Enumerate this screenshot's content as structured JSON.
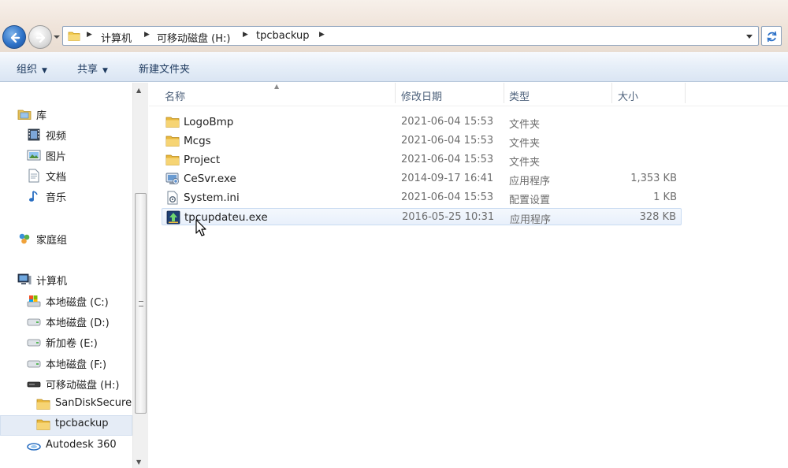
{
  "address_bar": {
    "crumbs": [
      "计算机",
      "可移动磁盘 (H:)",
      "tpcbackup"
    ]
  },
  "command_bar": {
    "organize": "组织",
    "share": "共享",
    "new_folder": "新建文件夹"
  },
  "nav_pane": {
    "libraries": {
      "label": "库",
      "items": [
        "视频",
        "图片",
        "文档",
        "音乐"
      ]
    },
    "homegroup": "家庭组",
    "computer": {
      "label": "计算机",
      "drives": [
        "本地磁盘 (C:)",
        "本地磁盘 (D:)",
        "新加卷 (E:)",
        "本地磁盘 (F:)",
        "可移动磁盘 (H:)"
      ],
      "subfolders": [
        "SanDiskSecure",
        "tpcbackup"
      ],
      "selected": "tpcbackup"
    },
    "autodesk": "Autodesk 360"
  },
  "file_list": {
    "columns": {
      "name": "名称",
      "date": "修改日期",
      "type": "类型",
      "size": "大小"
    },
    "rows": [
      {
        "name": "LogoBmp",
        "date": "2021-06-04 15:53",
        "type": "文件夹",
        "size": "",
        "icon": "folder-icon"
      },
      {
        "name": "Mcgs",
        "date": "2021-06-04 15:53",
        "type": "文件夹",
        "size": "",
        "icon": "folder-icon"
      },
      {
        "name": "Project",
        "date": "2021-06-04 15:53",
        "type": "文件夹",
        "size": "",
        "icon": "folder-icon"
      },
      {
        "name": "CeSvr.exe",
        "date": "2014-09-17 16:41",
        "type": "应用程序",
        "size": "1,353 KB",
        "icon": "exe-monitor-icon"
      },
      {
        "name": "System.ini",
        "date": "2021-06-04 15:53",
        "type": "配置设置",
        "size": "1 KB",
        "icon": "ini-settings-icon"
      },
      {
        "name": "tpcupdateu.exe",
        "date": "2016-05-25 10:31",
        "type": "应用程序",
        "size": "328 KB",
        "icon": "exe-update-icon"
      }
    ],
    "hovered": "tpcupdateu.exe"
  },
  "colors": {
    "accent": "#2f73c8",
    "folder": "#f2c94c",
    "selection": "#e5ecf6"
  }
}
